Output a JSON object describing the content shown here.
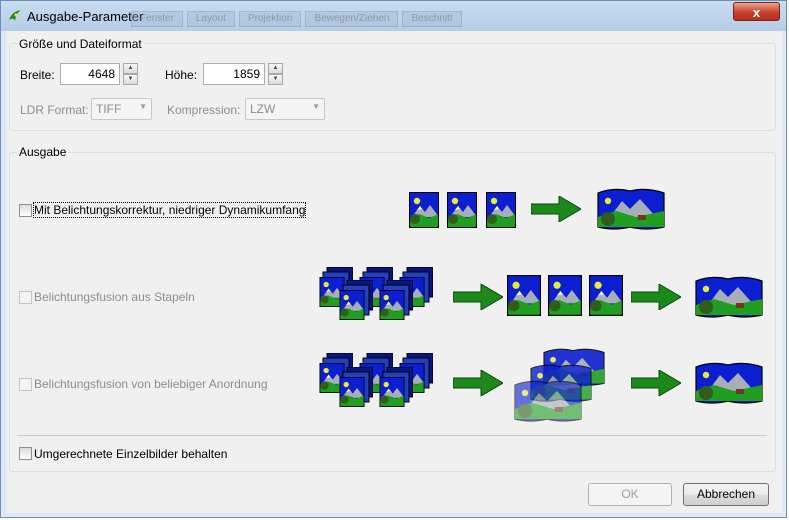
{
  "window": {
    "title": "Ausgabe-Parameter",
    "close_glyph": "x"
  },
  "background_tabs": [
    "Fenster",
    "Layout",
    "Projektion",
    "Bewegen/Ziehen",
    "Beschnitt"
  ],
  "size_group": {
    "title": "Größe und Dateiformat",
    "width_label": "Breite:",
    "width_value": "4648",
    "height_label": "Höhe:",
    "height_value": "1859",
    "ldr_format_label": "LDR Format:",
    "ldr_format_value": "TIFF",
    "compression_label": "Kompression:",
    "compression_value": "LZW"
  },
  "output_group": {
    "title": "Ausgabe",
    "options": [
      {
        "label": "Mit Belichtungskorrektur, niedriger Dynamikumfang",
        "checked": false,
        "enabled": true
      },
      {
        "label": "Belichtungsfusion aus Stapeln",
        "checked": false,
        "enabled": false
      },
      {
        "label": "Belichtungsfusion von beliebiger Anordnung",
        "checked": false,
        "enabled": false
      }
    ],
    "keep_images_label": "Umgerechnete Einzelbilder behalten"
  },
  "buttons": {
    "ok": "OK",
    "cancel": "Abbrechen"
  },
  "colors": {
    "sky": "#0b1fd0",
    "grass": "#1f9e1f",
    "arrow": "#1b8a1b",
    "mountain": "#a7aeb7",
    "sun": "#e8ea3a"
  }
}
